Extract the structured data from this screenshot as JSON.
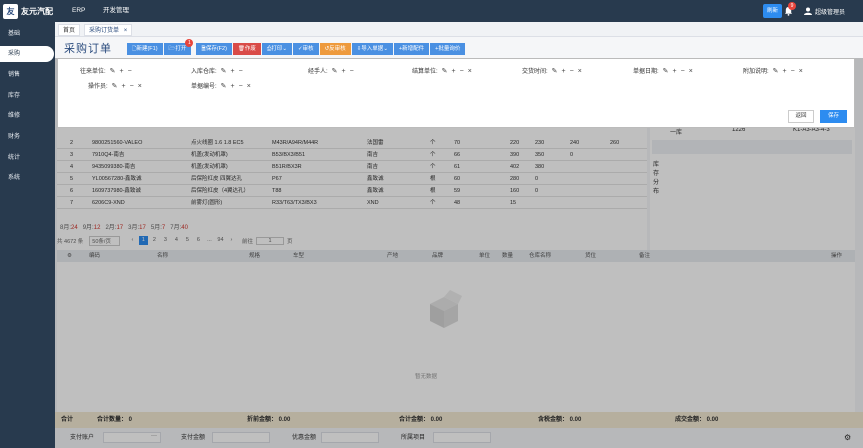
{
  "app": {
    "name": "友元汽配",
    "nav": [
      "ERP",
      "开发管理"
    ],
    "refresh_label": "刷新",
    "bell_count": "9",
    "user": "超级管理员"
  },
  "sidebar": {
    "items": [
      {
        "label": "基础",
        "active": false
      },
      {
        "label": "采购",
        "active": true
      },
      {
        "label": "销售",
        "active": false
      },
      {
        "label": "库存",
        "active": false
      },
      {
        "label": "维修",
        "active": false
      },
      {
        "label": "财务",
        "active": false
      },
      {
        "label": "统计",
        "active": false
      },
      {
        "label": "系统",
        "active": false
      }
    ]
  },
  "tabs": [
    {
      "label": "首页"
    },
    {
      "label": "采购订货单",
      "closable": true
    }
  ],
  "page_title": "采购订单",
  "toolbar": [
    {
      "label": "新建(F1)",
      "color": "#4a90e2"
    },
    {
      "label": "打开",
      "color": "#4a90e2",
      "badge": "1"
    },
    {
      "label": "保存(F2)",
      "color": "#4a90e2"
    },
    {
      "label": "作废",
      "color": "#d94b48"
    },
    {
      "label": "打印",
      "color": "#4a90e2"
    },
    {
      "label": "审核",
      "color": "#4a90e2"
    },
    {
      "label": "反审核",
      "color": "#ee9a3d"
    },
    {
      "label": "导入单据",
      "color": "#4a90e2"
    },
    {
      "label": "新增配件",
      "color": "#4a90e2"
    },
    {
      "label": "批量询价",
      "color": "#4a90e2"
    }
  ],
  "modal": {
    "fields": [
      {
        "label": "往来单位:"
      },
      {
        "label": "入库仓库:"
      },
      {
        "label": "经手人:"
      },
      {
        "label": "结算单位:"
      },
      {
        "label": "交货时间:"
      },
      {
        "label": "单据日期:"
      },
      {
        "label": "附加说明:"
      },
      {
        "label": "操作员:"
      },
      {
        "label": "单据编号:"
      }
    ],
    "back_label": "返回",
    "save_label": "保存"
  },
  "grid": {
    "rows": [
      {
        "no": "2",
        "code": "9800251560-VALEO",
        "name": "点火线圈 1.6 1.8 EC5",
        "model": "M43R/A94R/M44R",
        "brand": "法国雷",
        "unit": "个",
        "qty": "70",
        "a": "220",
        "b": "230",
        "c": "240",
        "d": "260"
      },
      {
        "no": "3",
        "code": "7910Q4-南吉",
        "name": "机盖(发动机罩)",
        "model": "B53/BX3/B51",
        "brand": "南吉",
        "unit": "个",
        "qty": "66",
        "a": "390",
        "b": "350",
        "c": "0",
        "d": ""
      },
      {
        "no": "4",
        "code": "9435099380-南吉",
        "name": "机盖(发动机罩)",
        "model": "B51R/BX3R",
        "brand": "南吉",
        "unit": "个",
        "qty": "61",
        "a": "402",
        "b": "380",
        "c": "",
        "d": ""
      },
      {
        "no": "5",
        "code": "YL00567280-鑫致诚",
        "name": "后保险杠皮 四翼达孔",
        "model": "P67",
        "brand": "鑫致诚",
        "unit": "根",
        "qty": "60",
        "a": "280",
        "b": "0",
        "c": "",
        "d": ""
      },
      {
        "no": "6",
        "code": "1609737980-鑫致诚",
        "name": "后保险杠皮（4翼达孔）",
        "model": "T88",
        "brand": "鑫致诚",
        "unit": "根",
        "qty": "59",
        "a": "160",
        "b": "0",
        "c": "",
        "d": ""
      },
      {
        "no": "7",
        "code": "6206C9-XND",
        "name": "前雾灯(圆形)",
        "model": "R33/T63/TX3/BX3",
        "brand": "XND",
        "unit": "个",
        "qty": "48",
        "a": "15",
        "b": "",
        "c": "",
        "d": ""
      }
    ]
  },
  "stats": [
    {
      "label": "8月:",
      "value": "24"
    },
    {
      "label": "9月:",
      "value": "12"
    },
    {
      "label": "2月:",
      "value": "17"
    },
    {
      "label": "3月:",
      "value": "17"
    },
    {
      "label": "5月:",
      "value": "7"
    },
    {
      "label": "7月:",
      "value": "40"
    }
  ],
  "pager": {
    "total": "共 4672 条",
    "page_size": "50条/页",
    "pages": [
      "1",
      "2",
      "3",
      "4",
      "5",
      "6",
      "...",
      "94"
    ],
    "goto_label": "前往",
    "goto_value": "1",
    "page_suffix": "页"
  },
  "right_panel": {
    "label1": "一库",
    "value1": "1226",
    "value2": "K1-A3-A3-4-3",
    "side_label": "库存分布"
  },
  "detail_header": [
    "编码",
    "名称",
    "规格",
    "车型",
    "产地",
    "品牌",
    "单位",
    "数量",
    "仓库名称",
    "货位",
    "备注",
    "操作"
  ],
  "empty_text": "暂无数据",
  "footer": {
    "total_label": "合计",
    "count": "合计数量： 0",
    "pre_discount": "折前金额： 0.00",
    "amount": "合计金额： 0.00",
    "tax": "含税金额： 0.00",
    "deal": "成交金额： 0.00"
  },
  "footer2": {
    "pay_account": "支付账户",
    "pay_amount": "支付金额",
    "discount_amount": "优惠金额",
    "project": "所属项目"
  }
}
